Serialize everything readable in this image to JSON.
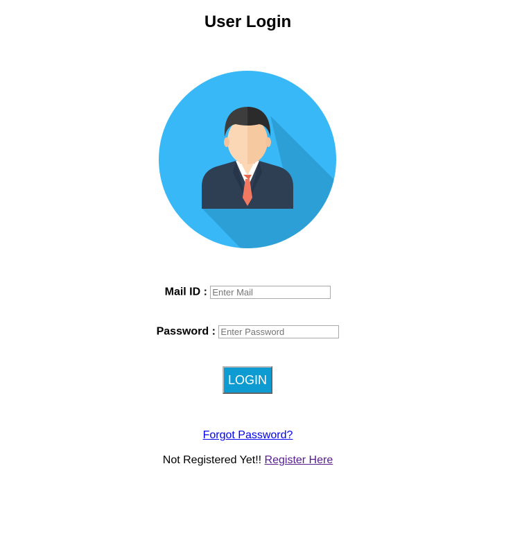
{
  "header": {
    "title": "User Login"
  },
  "avatar": {
    "icon": "user-avatar-icon",
    "colors": {
      "circle": "#38b8f7",
      "shadow": "#2c9fd6",
      "suit": "#2f3f53",
      "hair": "#333333",
      "face": "#fcd7b5",
      "tie": "#f27961",
      "shirt": "#ffffff"
    }
  },
  "form": {
    "mail_label": "Mail ID :",
    "mail_placeholder": "Enter Mail",
    "mail_value": "",
    "password_label": "Password :",
    "password_placeholder": "Enter Password",
    "password_value": "",
    "login_label": "LOGIN",
    "login_bg": "#0e9bd1"
  },
  "links": {
    "forgot_password": "Forgot Password?",
    "not_registered": "Not Registered Yet!!",
    "register_here": "Register Here"
  }
}
